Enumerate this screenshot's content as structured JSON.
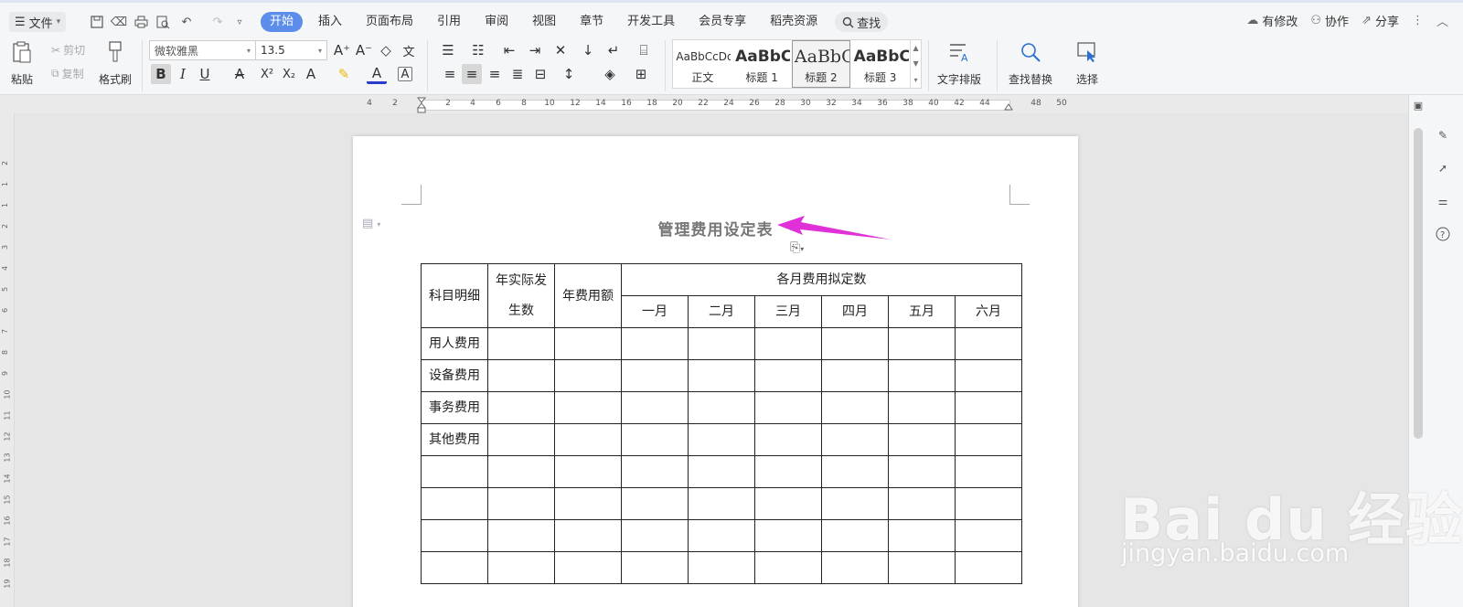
{
  "menubar": {
    "file_label": "文件",
    "tabs": [
      "开始",
      "插入",
      "页面布局",
      "引用",
      "审阅",
      "视图",
      "章节",
      "开发工具",
      "会员专享",
      "稻壳资源"
    ],
    "search_label": "查找",
    "has_changes": "有修改",
    "collaborate": "协作",
    "share": "分享"
  },
  "ribbon": {
    "paste": "粘贴",
    "cut": "剪切",
    "copy": "复制",
    "format_painter": "格式刷",
    "font_name": "微软雅黑",
    "font_size": "13.5",
    "styles": [
      {
        "preview": "AaBbCcDd",
        "name": "正文"
      },
      {
        "preview": "AaBbCc",
        "name": "标题 1"
      },
      {
        "preview": "AaBbC",
        "name": "标题 2"
      },
      {
        "preview": "AaBbC",
        "name": "标题 3"
      }
    ],
    "text_layout": "文字排版",
    "find_replace": "查找替换",
    "select": "选择"
  },
  "ruler": {
    "h_numbers": [
      "4",
      "2",
      "2",
      "4",
      "6",
      "8",
      "10",
      "12",
      "14",
      "16",
      "18",
      "20",
      "22",
      "24",
      "26",
      "28",
      "30",
      "32",
      "34",
      "36",
      "38",
      "40",
      "42",
      "44",
      "48",
      "50"
    ],
    "v_numbers": [
      "2",
      "1",
      "1",
      "2",
      "3",
      "4",
      "5",
      "6",
      "7",
      "8",
      "9",
      "10",
      "11",
      "12",
      "13",
      "14",
      "15",
      "16",
      "17",
      "18",
      "19"
    ]
  },
  "document": {
    "title": "管理费用设定表",
    "table": {
      "col_subject": "科目明细",
      "col_actual_line1": "年实际发",
      "col_actual_line2": "生数",
      "col_annual": "年费用额",
      "col_monthly": "各月费用拟定数",
      "months": [
        "一月",
        "二月",
        "三月",
        "四月",
        "五月",
        "六月"
      ],
      "rows": [
        "用人费用",
        "设备费用",
        "事务费用",
        "其他费用",
        "",
        "",
        "",
        ""
      ]
    }
  },
  "watermark": {
    "main": "Bai du 经验",
    "sub": "jingyan.baidu.com"
  },
  "colors": {
    "accent": "#5c8dea",
    "arrow": "#e030d8"
  }
}
